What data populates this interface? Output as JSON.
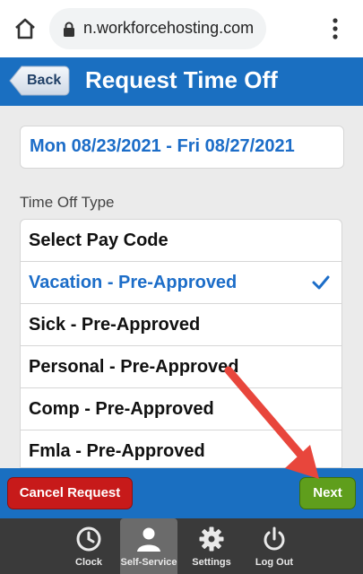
{
  "browser": {
    "url": "n.workforcehosting.com",
    "icons": [
      "home-icon",
      "lock-icon",
      "kebab-menu-icon"
    ]
  },
  "header": {
    "back_label": "Back",
    "title": "Request Time Off"
  },
  "date_range": "Mon 08/23/2021 - Fri 08/27/2021",
  "time_off_type_label": "Time Off Type",
  "time_off_types": [
    {
      "label": "Select Pay Code",
      "selected": false
    },
    {
      "label": "Vacation - Pre-Approved",
      "selected": true
    },
    {
      "label": "Sick - Pre-Approved",
      "selected": false
    },
    {
      "label": "Personal - Pre-Approved",
      "selected": false
    },
    {
      "label": "Comp - Pre-Approved",
      "selected": false
    },
    {
      "label": "Fmla - Pre-Approved",
      "selected": false
    }
  ],
  "actions": {
    "cancel_label": "Cancel Request",
    "next_label": "Next"
  },
  "tabs": [
    {
      "label": "Clock",
      "icon": "clock-icon",
      "active": false
    },
    {
      "label": "Self-Service",
      "icon": "person-icon",
      "active": true
    },
    {
      "label": "Settings",
      "icon": "gear-icon",
      "active": false
    },
    {
      "label": "Log Out",
      "icon": "power-icon",
      "active": false
    }
  ],
  "colors": {
    "header_blue": "#1a6fc1",
    "selected_text": "#1c6dc8",
    "cancel_red": "#c71a1a",
    "next_green": "#5f9e1c",
    "tabbar": "#3a3a3a",
    "annotation_arrow": "#e8463c"
  }
}
